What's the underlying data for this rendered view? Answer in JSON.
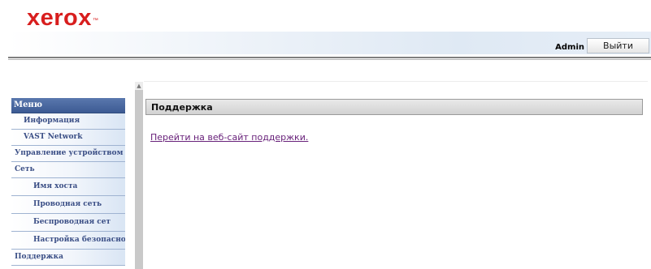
{
  "header": {
    "logo_text": "xerox",
    "logo_mark": "™",
    "user_label": "Admin",
    "logout_label": "Выйти"
  },
  "sidebar": {
    "menu_title": "Меню",
    "items": [
      {
        "label": "Информация",
        "level": 1
      },
      {
        "label": "VAST Network",
        "level": 1
      },
      {
        "label": "Управление устройством",
        "level": 0
      },
      {
        "label": "Сеть",
        "level": 0
      },
      {
        "label": "Имя хоста",
        "level": 2
      },
      {
        "label": "Проводная сеть",
        "level": 2
      },
      {
        "label": "Беспроводная сет",
        "level": 2
      },
      {
        "label": "Настройка безопасности",
        "level": 2
      },
      {
        "label": "Поддержка",
        "level": 0
      }
    ]
  },
  "main": {
    "section_title": "Поддержка",
    "support_link": "Перейти на веб-сайт поддержки."
  },
  "colors": {
    "brand_red": "#d81e1e",
    "menu_header": "#3c5a93",
    "menu_text": "#3b4f86",
    "link_visited": "#68217a"
  }
}
